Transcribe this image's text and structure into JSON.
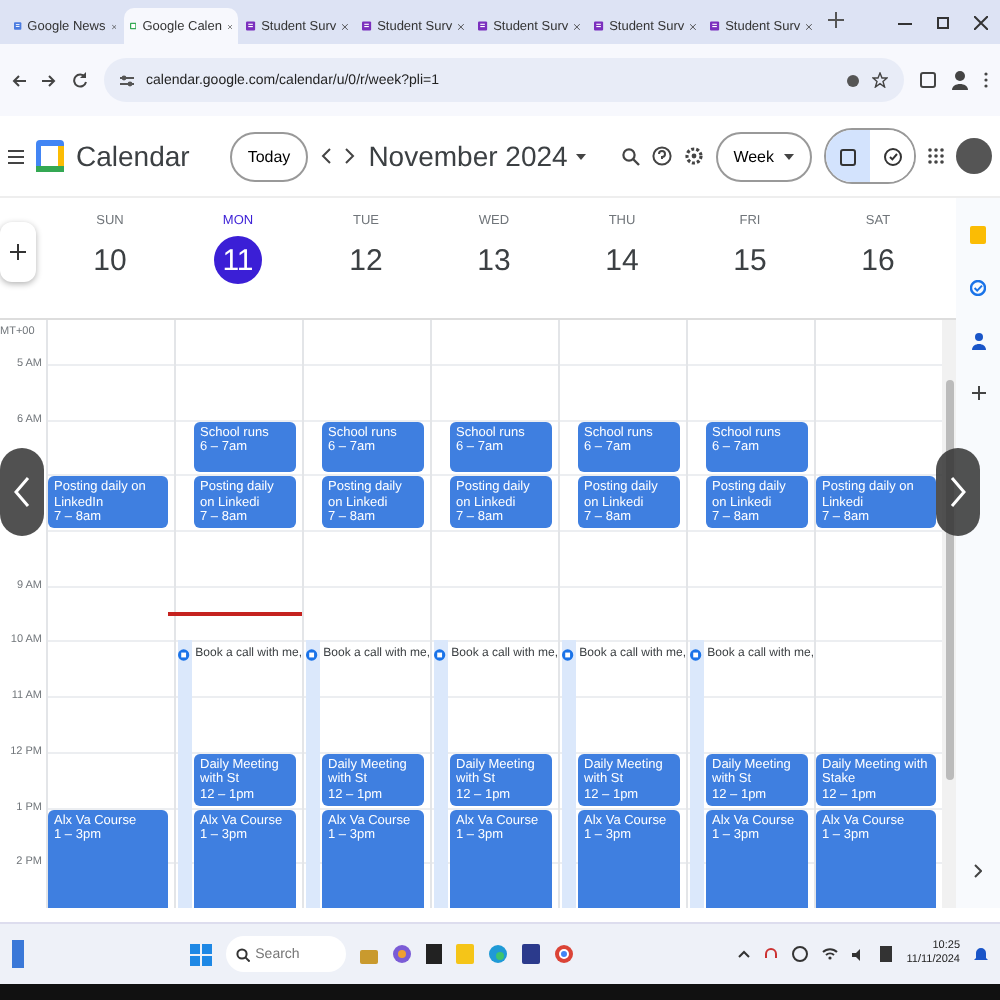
{
  "browser": {
    "tabs": [
      {
        "title": "Google News",
        "selected": false,
        "kind": "news"
      },
      {
        "title": "Google Calen",
        "selected": true,
        "kind": "calendar"
      },
      {
        "title": "Student Surv",
        "selected": false,
        "kind": "form"
      },
      {
        "title": "Student Surv",
        "selected": false,
        "kind": "form"
      },
      {
        "title": "Student Surv",
        "selected": false,
        "kind": "form"
      },
      {
        "title": "Student Surv",
        "selected": false,
        "kind": "form"
      },
      {
        "title": "Student Surv",
        "selected": false,
        "kind": "form"
      }
    ],
    "url": "calendar.google.com/calendar/u/0/r/week?pli=1"
  },
  "header": {
    "app_name": "Calendar",
    "today_button": "Today",
    "period": "November 2024",
    "view": "Week",
    "view_toggle": [
      {
        "kind": "calendar",
        "selected": true
      },
      {
        "kind": "tasks",
        "selected": false
      }
    ]
  },
  "calendar": {
    "timezone_label": "MT+00",
    "hours": [
      "5 AM",
      "6 AM",
      "9 AM",
      "10 AM",
      "11 AM",
      "12 PM",
      "1 PM",
      "2 PM"
    ],
    "days": [
      {
        "dow": "SUN",
        "date": "10",
        "today": false,
        "events": [
          {
            "kind": "event",
            "title": "Posting daily on LinkedIn",
            "time": "7 – 8am"
          },
          {
            "kind": "event",
            "title": "Alx Va Course",
            "time": "1 – 3pm"
          }
        ]
      },
      {
        "dow": "MON",
        "date": "11",
        "today": true,
        "events": [
          {
            "kind": "event",
            "title": "School runs",
            "time": "6 – 7am"
          },
          {
            "kind": "event",
            "title": "Posting daily on Linkedi",
            "time": "7 – 8am"
          },
          {
            "kind": "appointment",
            "title": "Book a call with me,"
          },
          {
            "kind": "event",
            "title": "Daily Meeting with St",
            "time": "12 – 1pm"
          },
          {
            "kind": "event",
            "title": "Alx Va Course",
            "time": "1 – 3pm"
          }
        ]
      },
      {
        "dow": "TUE",
        "date": "12",
        "today": false,
        "events": [
          {
            "kind": "event",
            "title": "School runs",
            "time": "6 – 7am"
          },
          {
            "kind": "event",
            "title": "Posting daily on Linkedi",
            "time": "7 – 8am"
          },
          {
            "kind": "appointment",
            "title": "Book a call with me,"
          },
          {
            "kind": "event",
            "title": "Daily Meeting with St",
            "time": "12 – 1pm"
          },
          {
            "kind": "event",
            "title": "Alx Va Course",
            "time": "1 – 3pm"
          }
        ]
      },
      {
        "dow": "WED",
        "date": "13",
        "today": false,
        "events": [
          {
            "kind": "event",
            "title": "School runs",
            "time": "6 – 7am"
          },
          {
            "kind": "event",
            "title": "Posting daily on Linkedi",
            "time": "7 – 8am"
          },
          {
            "kind": "appointment",
            "title": "Book a call with me,"
          },
          {
            "kind": "event",
            "title": "Daily Meeting with St",
            "time": "12 – 1pm"
          },
          {
            "kind": "event",
            "title": "Alx Va Course",
            "time": "1 – 3pm"
          }
        ]
      },
      {
        "dow": "THU",
        "date": "14",
        "today": false,
        "events": [
          {
            "kind": "event",
            "title": "School runs",
            "time": "6 – 7am"
          },
          {
            "kind": "event",
            "title": "Posting daily on Linkedi",
            "time": "7 – 8am"
          },
          {
            "kind": "appointment",
            "title": "Book a call with me,"
          },
          {
            "kind": "event",
            "title": "Daily Meeting with St",
            "time": "12 – 1pm"
          },
          {
            "kind": "event",
            "title": "Alx Va Course",
            "time": "1 – 3pm"
          }
        ]
      },
      {
        "dow": "FRI",
        "date": "15",
        "today": false,
        "events": [
          {
            "kind": "event",
            "title": "School runs",
            "time": "6 – 7am"
          },
          {
            "kind": "event",
            "title": "Posting daily on Linkedi",
            "time": "7 – 8am"
          },
          {
            "kind": "appointment",
            "title": "Book a call with me,"
          },
          {
            "kind": "event",
            "title": "Daily Meeting with St",
            "time": "12 – 1pm"
          },
          {
            "kind": "event",
            "title": "Alx Va Course",
            "time": "1 – 3pm"
          }
        ]
      },
      {
        "dow": "SAT",
        "date": "16",
        "today": false,
        "events": [
          {
            "kind": "event",
            "title": "Posting daily on Linkedi",
            "time": "7 – 8am"
          },
          {
            "kind": "event",
            "title": "Daily Meeting with Stake",
            "time": "12 – 1pm"
          },
          {
            "kind": "event",
            "title": "Alx Va Course",
            "time": "1 – 3pm"
          }
        ]
      }
    ]
  },
  "taskbar": {
    "search_placeholder": "Search",
    "time": "10:25",
    "date": "11/11/2024"
  }
}
